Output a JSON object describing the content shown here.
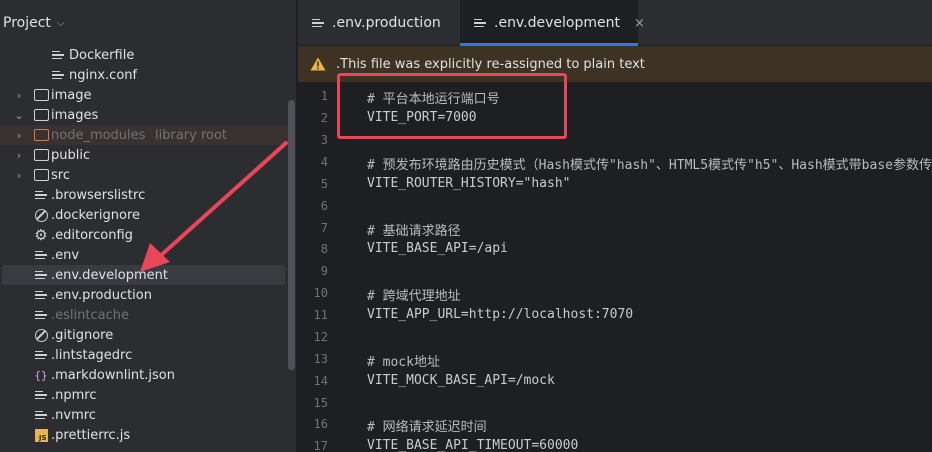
{
  "project_panel": {
    "title": "Project",
    "items": [
      {
        "label": "Dockerfile",
        "icon": "file-icon"
      },
      {
        "label": "nginx.conf",
        "icon": "file-icon"
      },
      {
        "label": "image",
        "icon": "folder-icon"
      },
      {
        "label": "images",
        "icon": "folder-icon"
      },
      {
        "label": "node_modules",
        "hint": "library root",
        "icon": "folder-icon"
      },
      {
        "label": "public",
        "icon": "folder-icon"
      },
      {
        "label": "src",
        "icon": "folder-icon"
      },
      {
        "label": ".browserslistrc",
        "icon": "file-icon"
      },
      {
        "label": ".dockerignore",
        "icon": "ignore-icon"
      },
      {
        "label": ".editorconfig",
        "icon": "gear-icon"
      },
      {
        "label": ".env",
        "icon": "file-icon"
      },
      {
        "label": ".env.development",
        "icon": "file-icon"
      },
      {
        "label": ".env.production",
        "icon": "file-icon"
      },
      {
        "label": ".eslintcache",
        "icon": "file-icon"
      },
      {
        "label": ".gitignore",
        "icon": "ignore-icon"
      },
      {
        "label": ".lintstagedrc",
        "icon": "file-icon"
      },
      {
        "label": ".markdownlint.json",
        "icon": "json-icon"
      },
      {
        "label": ".npmrc",
        "icon": "file-icon"
      },
      {
        "label": ".nvmrc",
        "icon": "file-icon"
      },
      {
        "label": ".prettierrc.js",
        "icon": "js-file-icon"
      }
    ]
  },
  "editor": {
    "tabs": [
      {
        "label": ".env.production",
        "active": false
      },
      {
        "label": ".env.development",
        "active": true,
        "close": "×"
      }
    ],
    "banner": ".This file was explicitly re-assigned to plain text",
    "lines": [
      {
        "n": "1",
        "text": "# 平台本地运行端口号",
        "kind": "comment"
      },
      {
        "n": "2",
        "text": "VITE_PORT=7000",
        "kind": "kv"
      },
      {
        "n": "3",
        "text": "",
        "kind": "kv"
      },
      {
        "n": "4",
        "text": "# 预发布环境路由历史模式（Hash模式传\"hash\"、HTML5模式传\"h5\"、Hash模式带base参数传",
        "kind": "comment"
      },
      {
        "n": "5",
        "text": "VITE_ROUTER_HISTORY=\"hash\"",
        "kind": "kv"
      },
      {
        "n": "6",
        "text": "",
        "kind": "kv"
      },
      {
        "n": "7",
        "text": "# 基础请求路径",
        "kind": "comment"
      },
      {
        "n": "8",
        "text": "VITE_BASE_API=/api",
        "kind": "kv"
      },
      {
        "n": "9",
        "text": "",
        "kind": "kv"
      },
      {
        "n": "10",
        "text": "# 跨域代理地址",
        "kind": "comment"
      },
      {
        "n": "11",
        "text": "VITE_APP_URL=http://localhost:7070",
        "kind": "kv"
      },
      {
        "n": "12",
        "text": "",
        "kind": "kv"
      },
      {
        "n": "13",
        "text": "# mock地址",
        "kind": "comment"
      },
      {
        "n": "14",
        "text": "VITE_MOCK_BASE_API=/mock",
        "kind": "kv"
      },
      {
        "n": "15",
        "text": "",
        "kind": "kv"
      },
      {
        "n": "16",
        "text": "# 网络请求延迟时间",
        "kind": "comment"
      },
      {
        "n": "17",
        "text": "VITE_BASE_API_TIMEOUT=60000",
        "kind": "kv"
      }
    ]
  },
  "colors": {
    "annotation": "#e8465a",
    "accent": "#3574f0",
    "banner_bg": "#3d3223"
  }
}
